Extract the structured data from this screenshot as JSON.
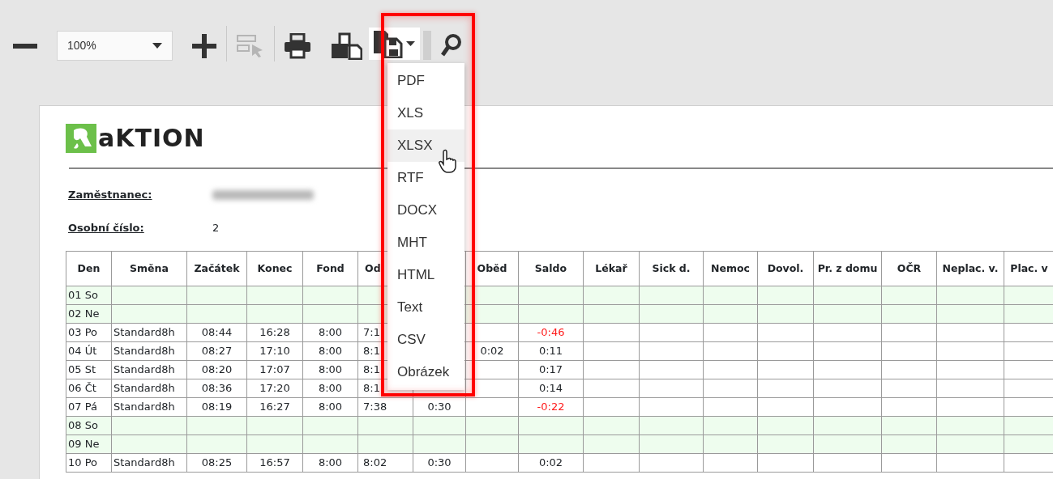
{
  "toolbar": {
    "zoom": {
      "value": "100%"
    },
    "select_tool_disabled": true
  },
  "export_menu": {
    "items": [
      {
        "label": "PDF",
        "hovered": false
      },
      {
        "label": "XLS",
        "hovered": false
      },
      {
        "label": "XLSX",
        "hovered": true
      },
      {
        "label": "RTF",
        "hovered": false
      },
      {
        "label": "DOCX",
        "hovered": false
      },
      {
        "label": "MHT",
        "hovered": false
      },
      {
        "label": "HTML",
        "hovered": false
      },
      {
        "label": "Text",
        "hovered": false
      },
      {
        "label": "CSV",
        "hovered": false
      },
      {
        "label": "Obrázek",
        "hovered": false
      }
    ]
  },
  "report": {
    "logo": "aKTION",
    "fields": [
      {
        "label": "Zaměstnanec:",
        "redacted": true
      },
      {
        "label": "Osobní číslo:",
        "value": "2"
      }
    ],
    "table": {
      "columns": [
        {
          "label": "Den"
        },
        {
          "label": "Směna"
        },
        {
          "label": "Začátek"
        },
        {
          "label": "Konec"
        },
        {
          "label": "Fond"
        },
        {
          "label": "Od"
        },
        {},
        {
          "label": "Oběd"
        },
        {
          "label": "Saldo"
        },
        {
          "label": "Lékař"
        },
        {
          "label": "Sick d."
        },
        {
          "label": "Nemoc"
        },
        {
          "label": "Dovol."
        },
        {
          "label": "Pr. z domu"
        },
        {
          "label": "OČR"
        },
        {
          "label": "Neplac. v."
        },
        {
          "label": "Plac. v"
        }
      ],
      "rows": [
        {
          "weekend": true,
          "cells": [
            "01 So",
            null,
            null,
            null,
            null,
            null,
            null,
            null,
            null,
            null,
            null,
            null,
            null,
            null,
            null,
            null,
            null
          ]
        },
        {
          "weekend": true,
          "cells": [
            "02 Ne",
            null,
            null,
            null,
            null,
            null,
            null,
            null,
            null,
            null,
            null,
            null,
            null,
            null,
            null,
            null,
            null
          ]
        },
        {
          "weekend": false,
          "saldo_negative": true,
          "cells": [
            "03 Po",
            "Standard8h",
            "08:44",
            "16:28",
            "8:00",
            "7:1",
            null,
            null,
            "-0:46",
            null,
            null,
            null,
            null,
            null,
            null,
            null,
            null
          ]
        },
        {
          "weekend": false,
          "saldo_negative": false,
          "cells": [
            "04 Út",
            "Standard8h",
            "08:27",
            "17:10",
            "8:00",
            "8:1",
            null,
            "0:02",
            "0:11",
            null,
            null,
            null,
            null,
            null,
            null,
            null,
            null
          ]
        },
        {
          "weekend": false,
          "saldo_negative": false,
          "cells": [
            "05 St",
            "Standard8h",
            "08:20",
            "17:07",
            "8:00",
            "8:1",
            null,
            null,
            "0:17",
            null,
            null,
            null,
            null,
            null,
            null,
            null,
            null
          ]
        },
        {
          "weekend": false,
          "saldo_negative": false,
          "cells": [
            "06 Čt",
            "Standard8h",
            "08:36",
            "17:20",
            "8:00",
            "8:1",
            null,
            null,
            "0:14",
            null,
            null,
            null,
            null,
            null,
            null,
            null,
            null
          ]
        },
        {
          "weekend": false,
          "saldo_negative": true,
          "cells": [
            "07 Pá",
            "Standard8h",
            "08:19",
            "16:27",
            "8:00",
            "7:38",
            "0:30",
            null,
            "-0:22",
            null,
            null,
            null,
            null,
            null,
            null,
            null,
            null
          ]
        },
        {
          "weekend": true,
          "cells": [
            "08 So",
            null,
            null,
            null,
            null,
            null,
            null,
            null,
            null,
            null,
            null,
            null,
            null,
            null,
            null,
            null,
            null
          ]
        },
        {
          "weekend": true,
          "cells": [
            "09 Ne",
            null,
            null,
            null,
            null,
            null,
            null,
            null,
            null,
            null,
            null,
            null,
            null,
            null,
            null,
            null,
            null
          ]
        },
        {
          "weekend": false,
          "saldo_negative": false,
          "cells": [
            "10 Po",
            "Standard8h",
            "08:25",
            "16:57",
            "8:00",
            "8:02",
            "0:30",
            null,
            "0:02",
            null,
            null,
            null,
            null,
            null,
            null,
            null,
            null
          ]
        }
      ]
    }
  }
}
